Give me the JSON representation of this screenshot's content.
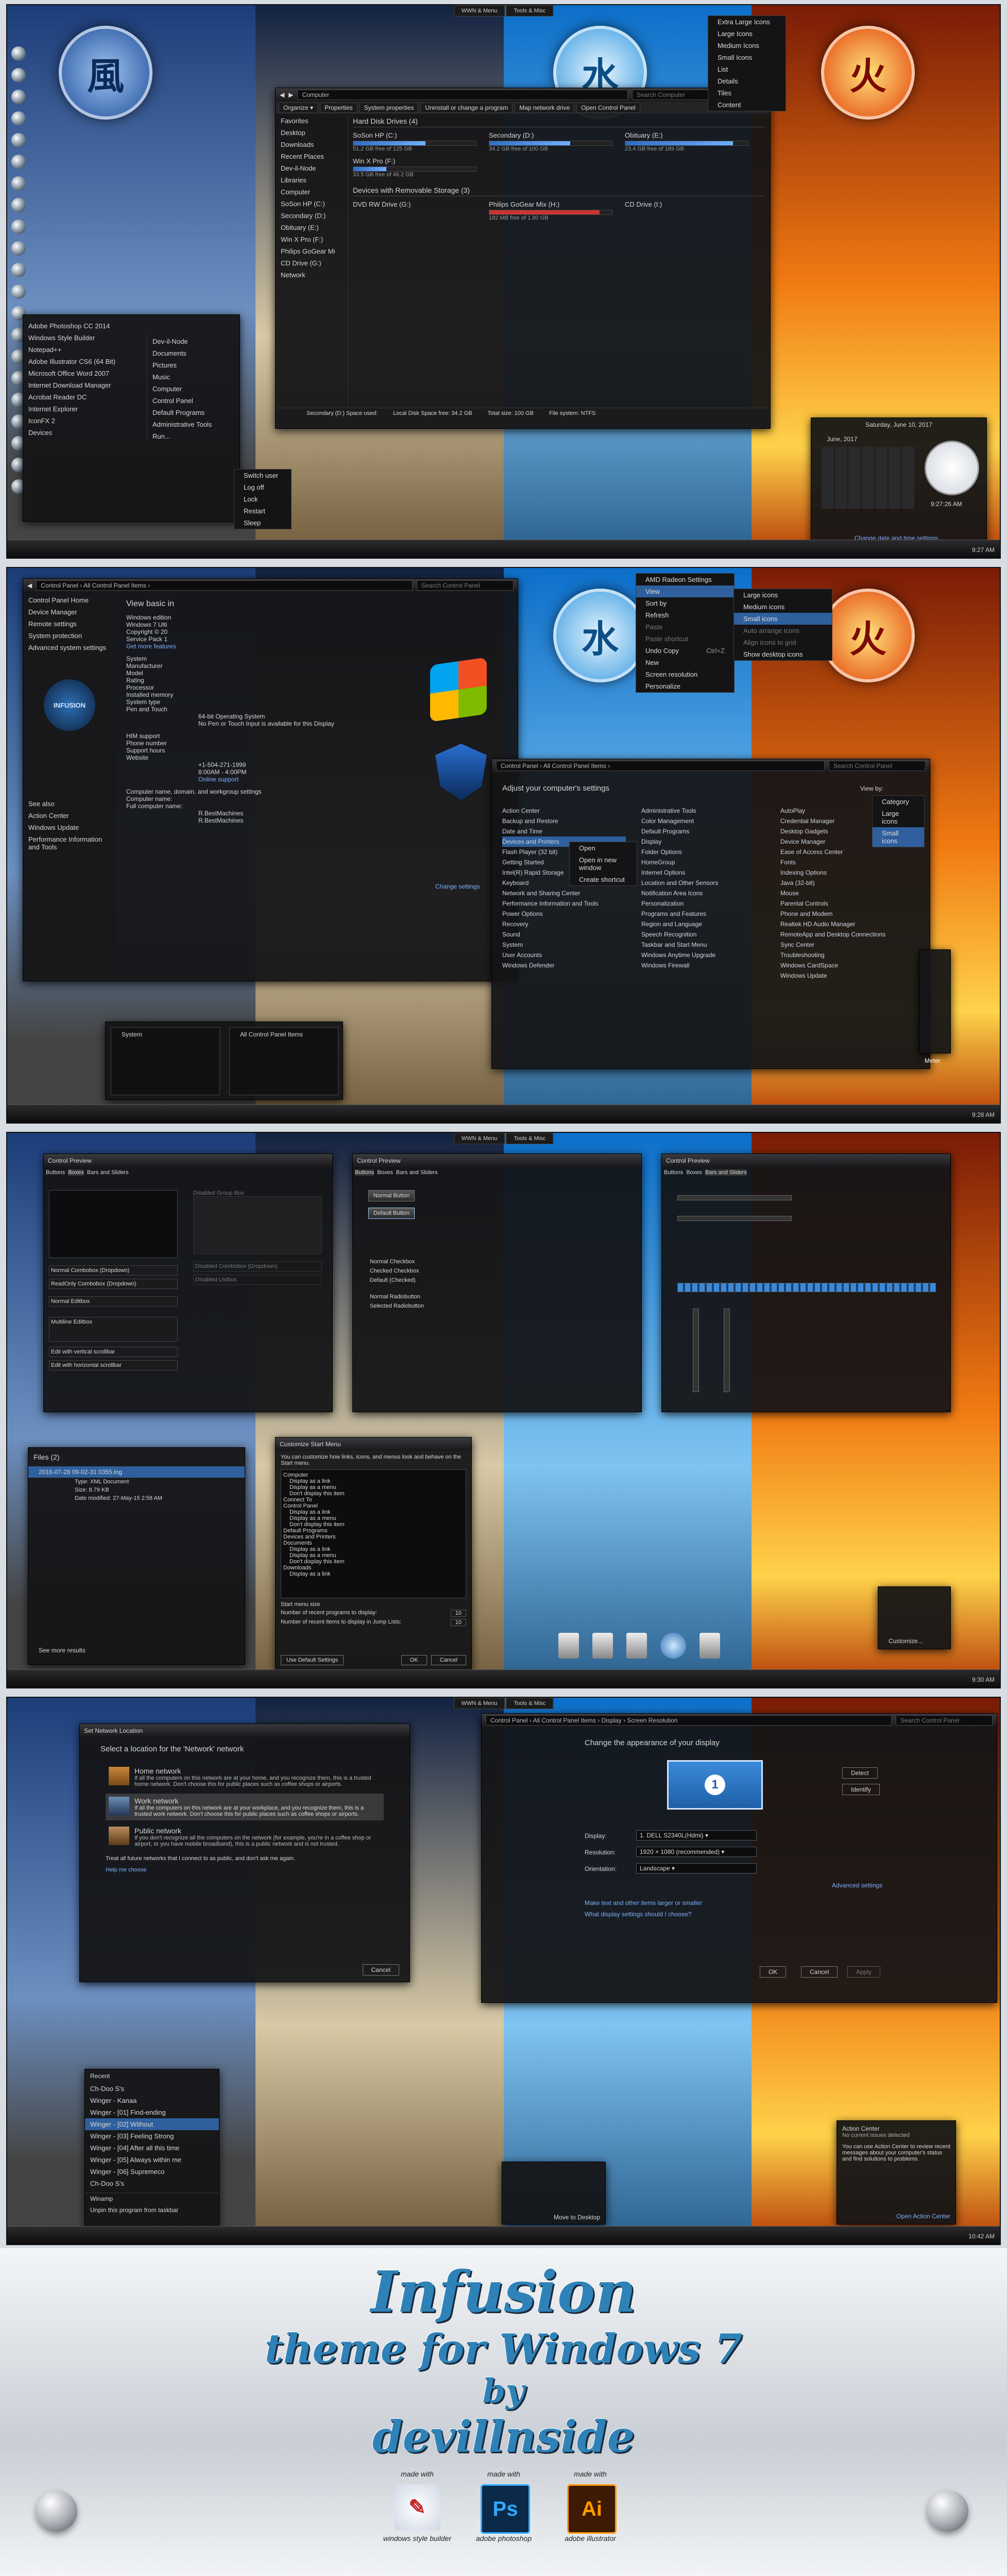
{
  "panel1": {
    "topbar": [
      "WWN & Menu",
      "Tools & Misc"
    ],
    "window": {
      "crumb": "Computer",
      "search": "Search Computer",
      "toolbar": [
        "Organize ▾",
        "Properties",
        "System properties",
        "Uninstall or change a program",
        "Map network drive",
        "Open Control Panel"
      ],
      "nav": [
        "Favorites",
        "Desktop",
        "Downloads",
        "Recent Places",
        "Dev-il-Node",
        "Libraries",
        "Computer",
        "SoSon HP (C:)",
        "Secondary (D:)",
        "Obituary (E:)",
        "Win X Pro (F:)",
        "Philips GoGear Mi",
        "CD Drive (G:)",
        "Network"
      ],
      "hdd_header": "Hard Disk Drives (4)",
      "drives": [
        {
          "name": "SoSon HP (C:)",
          "free": "51.2 GB free of 125 GB",
          "fill": 0.59
        },
        {
          "name": "Secondary (D:)",
          "free": "34.2 GB free of 100 GB",
          "fill": 0.66
        },
        {
          "name": "Obituary (E:)",
          "free": "23.4 GB free of 189 GB",
          "fill": 0.88
        },
        {
          "name": "Win X Pro (F:)",
          "free": "33.5 GB free of 46.2 GB",
          "fill": 0.27
        }
      ],
      "removable_header": "Devices with Removable Storage (3)",
      "removable": [
        {
          "name": "DVD RW Drive (G:)",
          "free": ""
        },
        {
          "name": "Philips GoGear Mix (H:)",
          "free": "182 MB free of 1.80 GB"
        },
        {
          "name": "CD Drive (I:)",
          "free": ""
        }
      ],
      "details": [
        "Secondary (D:)  Space used:",
        "Local Disk  Space free: 34.2 GB",
        "Total size: 100 GB",
        "File system: NTFS"
      ]
    },
    "view_menu": [
      "Extra Large Icons",
      "Large Icons",
      "Medium Icons",
      "Small Icons",
      "List",
      "Details",
      "Tiles",
      "Content"
    ],
    "start_left": [
      "Adobe Photoshop CC 2014",
      "Windows Style Builder",
      "Notepad++",
      "Adobe Illustrator CS6 (64 Bit)",
      "Microsoft Office Word 2007",
      "Internet Download Manager",
      "Acrobat Reader DC",
      "Internet Explorer",
      "IconFX 2",
      "Devices"
    ],
    "start_right": [
      "Dev-il-Node",
      "Documents",
      "Pictures",
      "Music",
      "Computer",
      "Control Panel",
      "Default Programs",
      "Administrative Tools",
      "Run..."
    ],
    "power": [
      "Switch user",
      "Log off",
      "Lock",
      "Restart",
      "Sleep"
    ],
    "calendar": {
      "header": "Saturday, June 10, 2017",
      "month": "June, 2017",
      "time": "9:27:26 AM",
      "link": "Change date and time settings..."
    },
    "tray": "9:27 AM"
  },
  "panel2": {
    "crumb": "Control Panel  ›  All Control Panel Items  ›",
    "search": "Search Control Panel",
    "left_links": [
      "Control Panel Home",
      "Device Manager",
      "Remote settings",
      "System protection",
      "Advanced system settings"
    ],
    "see_also": [
      "See also",
      "Action Center",
      "Windows Update",
      "Performance Information and Tools"
    ],
    "view_basic": "View basic in",
    "system_rows": [
      "Windows edition",
      "Windows 7 Ulti",
      "Copyright © 20",
      "Service Pack 1",
      "Get more features",
      "System",
      "Manufacturer",
      "Model",
      "Rating",
      "Processor",
      "Installed memory",
      "System type",
      "Pen and Touch"
    ],
    "system_vals": [
      "64-bit Operating System",
      "No Pen or Touch Input is available for this Display"
    ],
    "support": [
      "HIM support",
      "Phone number",
      "Support hours",
      "Website"
    ],
    "support_vals": [
      "+1-504-271-1999",
      "8:00AM - 4:00PM",
      "Online support"
    ],
    "computer_name": [
      "Computer name, domain, and workgroup settings",
      "Computer name:",
      "Full computer name:"
    ],
    "computer_vals": [
      "R.BestMachines",
      "R.BestMachines"
    ],
    "change_settings": "Change settings",
    "infusion": "INFUSION",
    "desktop_menu": [
      "AMD Radeon Settings",
      "View",
      "Sort by",
      "Refresh",
      "Paste",
      "Paste shortcut",
      "Undo Copy",
      "New",
      "Screen resolution",
      "Personalize"
    ],
    "undo_shortcut": "Ctrl+Z",
    "view_sub": [
      "Large icons",
      "Medium icons",
      "Small icons",
      "Auto arrange icons",
      "Align icons to grid",
      "Show desktop icons"
    ],
    "cp2_title": "Adjust your computer's settings",
    "viewby": "View by:",
    "viewby_opts": [
      "Category",
      "Large icons",
      "Small icons"
    ],
    "cp_col1": [
      "Action Center",
      "Backup and Restore",
      "Date and Time",
      "Devices and Printers",
      "Flash Player (32 bit)",
      "Getting Started",
      "Intel(R) Rapid Storage",
      "Keyboard",
      "Network and Sharing Center",
      "Performance Information and Tools",
      "Power Options",
      "Recovery",
      "Sound",
      "System",
      "User Accounts",
      "Windows Defender"
    ],
    "cp_col2": [
      "Administrative Tools",
      "Color Management",
      "Default Programs",
      "Display",
      "Folder Options",
      "HomeGroup",
      "Internet Options",
      "Location and Other Sensors",
      "Notification Area Icons",
      "Personalization",
      "Programs and Features",
      "Region and Language",
      "Speech Recognition",
      "Taskbar and Start Menu",
      "Windows Anytime Upgrade",
      "Windows Firewall"
    ],
    "cp_col3": [
      "AutoPlay",
      "Credential Manager",
      "Desktop Gadgets",
      "Device Manager",
      "Ease of Access Center",
      "Fonts",
      "Indexing Options",
      "Java (32-bit)",
      "Mouse",
      "Parental Controls",
      "Phone and Modem",
      "Realtek HD Audio Manager",
      "RemoteApp and Desktop Connections",
      "Sync Center",
      "Troubleshooting",
      "Windows CardSpace",
      "Windows Update"
    ],
    "ctx2": [
      "Open",
      "Open in new window",
      "Create shortcut"
    ],
    "thumbs": [
      "System",
      "All Control Panel Items"
    ],
    "meter": "Meter",
    "tray": "9:28 AM"
  },
  "panel3": {
    "preview1": {
      "title": "Control Preview",
      "tabs": [
        "Buttons",
        "Boxes",
        "Bars and Sliders"
      ],
      "rows": [
        "Normal Combobox (Dropdown)",
        "ReadOnly Combobox (Dropdown)",
        "Normal Editbox",
        "Multiline Editbox",
        "Edit with vertical scrollbar",
        "Edit with horizontal scrollbar"
      ],
      "disabled": [
        "Disabled Combobox (Dropdown)",
        "Disabled Listbox",
        "Disabled Group Box"
      ]
    },
    "preview2": {
      "title": "Control Preview",
      "tabs": [
        "Buttons",
        "Boxes",
        "Bars and Sliders"
      ],
      "buttons": [
        "Normal Button",
        "Default Button"
      ],
      "checks": [
        "Normal Checkbox",
        "Checked Checkbox",
        "Default (Checked)",
        "Normal Radiobutton",
        "Selected Radiobutton"
      ]
    },
    "preview3": {
      "title": "Control Preview",
      "tabs": [
        "Buttons",
        "Boxes",
        "Bars and Sliders"
      ]
    },
    "files": {
      "header": "Files (2)",
      "item": "2016-07-28  09-02-31 0355.log",
      "type": "Type: XML Document",
      "size": "Size: 8.79 KB",
      "date": "Date modified: 27-May-15 2:58 AM",
      "more": "See more results"
    },
    "customize": {
      "title": "Customize Start Menu",
      "desc": "You can customize how links, icons, and menus look and behave on the Start menu.",
      "items": [
        "Computer",
        "Display as a link",
        "Display as a menu",
        "Don't display this item",
        "Connect To",
        "Control Panel",
        "Display as a link",
        "Display as a menu",
        "Don't display this item",
        "Default Programs",
        "Devices and Printers",
        "Documents",
        "Display as a link",
        "Display as a menu",
        "Don't display this item",
        "Downloads",
        "Display as a link"
      ],
      "size_label": "Start menu size",
      "recent": "Number of recent programs to display:",
      "jump": "Number of recent items to display in Jump Lists:",
      "recent_val": "10",
      "jump_val": "10",
      "defaults": "Use Default Settings",
      "ok": "OK",
      "cancel": "Cancel"
    },
    "gadget": "Customize...",
    "tray": "9:30 AM"
  },
  "panel4": {
    "network": {
      "title": "Set Network Location",
      "heading": "Select a location for the 'Network' network",
      "home": "Home network",
      "home_desc": "If all the computers on this network are at your home, and you recognize them, this is a trusted home network. Don't choose this for public places such as coffee shops or airports.",
      "work": "Work network",
      "work_desc": "If all the computers on this network are at your workplace, and you recognize them, this is a trusted work network. Don't choose this for public places such as coffee shops or airports.",
      "public": "Public network",
      "public_desc": "If you don't recognize all the computers on the network (for example, you're in a coffee shop or airport, or you have mobile broadband), this is a public network and is not trusted.",
      "treat": "Treat all future networks that I connect to as public, and don't ask me again.",
      "help": "Help me choose",
      "cancel": "Cancel"
    },
    "display": {
      "crumb": "Control Panel  ›  All Control Panel Items  ›  Display  ›  Screen Resolution",
      "search": "Search Control Panel",
      "title": "Change the appearance of your display",
      "monitor": "1",
      "detect": "Detect",
      "identify": "Identify",
      "labels": [
        "Display:",
        "Resolution:",
        "Orientation:"
      ],
      "values": [
        "1. DELL S2340L(Hdmi) ▾",
        "1920 × 1080 (recommended) ▾",
        "Landscape ▾"
      ],
      "advanced": "Advanced settings",
      "links": [
        "Make text and other items larger or smaller",
        "What display settings should I choose?"
      ],
      "ok": "OK",
      "cancel": "Cancel",
      "apply": "Apply"
    },
    "jumplist": {
      "header": "Recent",
      "items": [
        "Ch-Doo S's",
        "Winger - Kanaa",
        "Winger - [01] Find-ending",
        "Winger - [02] Without",
        "Winger - [03] Feeling Strong",
        "Winger - [04] After all this time",
        "Winger - [05] Always within me",
        "Winger - [06] Supremeco",
        "Ch-Doo S's"
      ],
      "pin": "Winamp",
      "unpin": "Unpin this program from taskbar"
    },
    "peek": "Move to Desktop",
    "action": {
      "title": "Action Center",
      "sub": "No current issues detected",
      "body": "You can use Action Center to review recent messages about your computer's status and find solutions to problems.",
      "link": "Open Action Center"
    },
    "tray": "10:42 AM"
  },
  "banner": {
    "line1": "Infusion",
    "line2": "theme for Windows 7",
    "line3": "by",
    "line4": "devillnside",
    "made": [
      {
        "top": "made with",
        "bottom": "windows style builder",
        "glyph": "✎"
      },
      {
        "top": "made with",
        "bottom": "adobe photoshop",
        "glyph": "Ps"
      },
      {
        "top": "made with",
        "bottom": "adobe illustrator",
        "glyph": "Ai"
      }
    ]
  },
  "colors": {
    "accent": "#2e6cc5",
    "banner_text": "#2f82b8",
    "photoshop": "#0b2a4a",
    "illustrator": "#3d1a02"
  }
}
